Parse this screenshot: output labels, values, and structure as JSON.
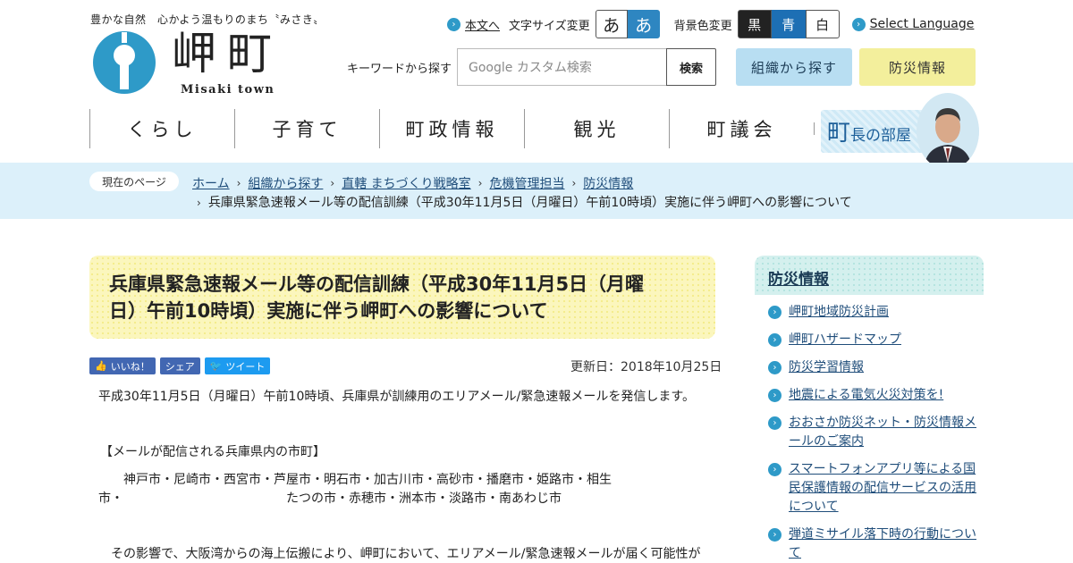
{
  "header": {
    "tagline": "豊かな自然　心かよう温もりのまち〝みさき〟",
    "logo_name": "岬町",
    "logo_sub": "Misaki town",
    "skip_link": "本文へ",
    "font_size_label": "文字サイズ変更",
    "font_size_normal": "あ",
    "font_size_large": "あ",
    "bg_color_label": "背景色変更",
    "bg_black": "黒",
    "bg_blue": "青",
    "bg_white": "白",
    "select_language": "Select Language",
    "search_label": "キーワードから探す",
    "search_placeholder": "Google カスタム検索",
    "search_button": "検索",
    "org_button": "組織から探す",
    "bousai_button": "防災情報",
    "colors": {
      "accent": "#2e9ac8",
      "org_bg": "#b8def2",
      "bousai_bg": "#f3ef9c"
    }
  },
  "gnav": {
    "items": [
      "くらし",
      "子育て",
      "町政情報",
      "観光",
      "町議会"
    ],
    "mayor_big": "町",
    "mayor_small": "長の部屋"
  },
  "breadcrumb": {
    "current_label": "現在のページ",
    "links": [
      "ホーム",
      "組織から探す",
      "直轄 まちづくり戦略室",
      "危機管理担当",
      "防災情報"
    ],
    "current": "兵庫県緊急速報メール等の配信訓練（平成30年11月5日（月曜日）午前10時頃）実施に伴う岬町への影響について"
  },
  "article": {
    "title_line1": "兵庫県緊急速報メール等の配信訓練（平成30年11月5日（月曜",
    "title_line2": "日）午前10時頃）実施に伴う岬町への影響について",
    "sns_like": "いいね！",
    "sns_share": "シェア",
    "sns_tweet": "ツイート",
    "updated": "更新日：2018年10月25日",
    "p1": "平成30年11月5日（月曜日）午前10時頃、兵庫県が訓練用のエリアメール/緊急速報メールを発信します。",
    "p2": "【メールが配信される兵庫県内の市町】",
    "p3a": "　　神戸市・尼崎市・西宮市・芦屋市・明石市・加古川市・高砂市・播磨市・姫路市・相生",
    "p3b": "市・　　　　　　　　　　　　　たつの市・赤穂市・洲本市・淡路市・南あわじ市",
    "p4": "　その影響で、大阪湾からの海上伝搬により、岬町において、エリアメール/緊急速報メールが届く可能性が"
  },
  "sidebar": {
    "heading": "防災情報",
    "items": [
      "岬町地域防災計画",
      "岬町ハザードマップ",
      "防災学習情報",
      "地震による電気火災対策を!",
      "おおさか防災ネット・防災情報メールのご案内",
      "スマートフォンアプリ等による国民保護情報の配信サービスの活用について",
      "弾道ミサイル落下時の行動について"
    ]
  }
}
